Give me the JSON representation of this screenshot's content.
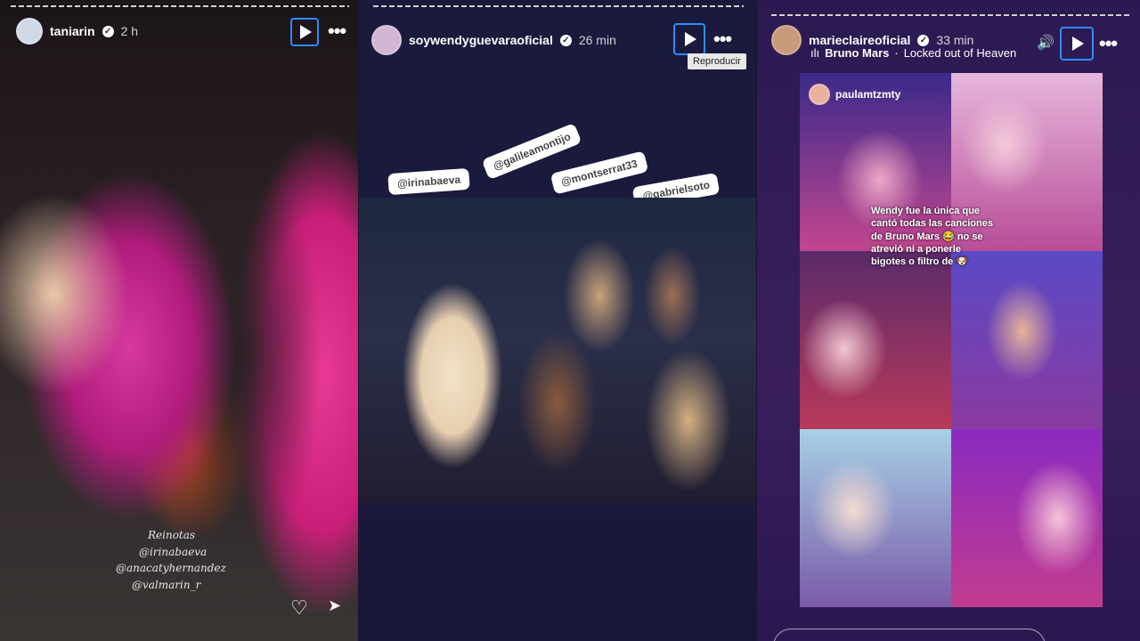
{
  "stories": [
    {
      "username": "taniarin",
      "time": "2 h",
      "overlay_lines": [
        "Reinotas",
        "@irinabaeva",
        "@anacatyhernandez",
        "@valmarin_r"
      ]
    },
    {
      "username": "soywendyguevaraoficial",
      "time": "26 min",
      "tooltip": "Reproducir",
      "mentions": [
        "@irinabaeva",
        "@galileamontijo",
        "@montserrat33",
        "@gabrielsoto"
      ]
    },
    {
      "username": "marieclaireoficial",
      "time": "33 min",
      "music_artist": "Bruno Mars",
      "music_title": "Locked out of Heaven",
      "tag_user": "paulamtzmty",
      "caption": "Wendy fue la única que cantó todas las canciones de Bruno Mars 😂 no se atrevió ni a ponerle bigotes o filtro de 🐶"
    }
  ],
  "icons": {
    "more": "•••",
    "heart": "♡",
    "send": "➤",
    "sound": "🔊"
  },
  "colors": {
    "play_outline": "#2f8cff"
  }
}
